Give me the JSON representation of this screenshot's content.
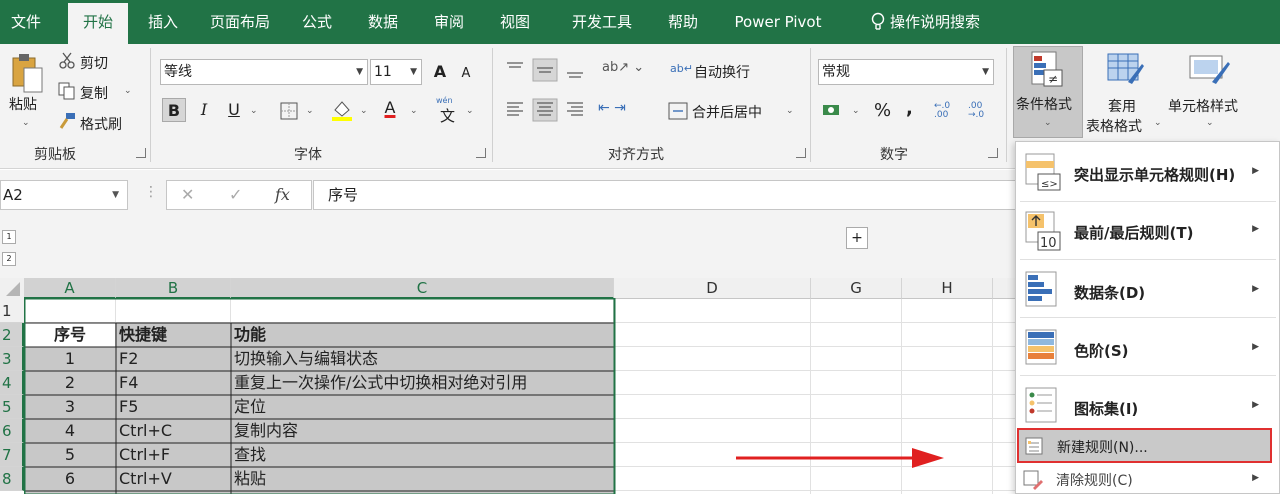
{
  "tabs": [
    "文件",
    "开始",
    "插入",
    "页面布局",
    "公式",
    "数据",
    "审阅",
    "视图",
    "开发工具",
    "帮助",
    "Power Pivot"
  ],
  "tell_me": "操作说明搜索",
  "ribbon": {
    "clipboard": {
      "paste": "粘贴",
      "cut": "剪切",
      "copy": "复制",
      "format_painter": "格式刷",
      "label": "剪贴板"
    },
    "font": {
      "name": "等线",
      "size": "11",
      "bold": "B",
      "italic": "I",
      "underline": "U",
      "phonetic": "wén",
      "phonetic_char": "文",
      "grow": "A",
      "shrink": "A",
      "font_color_letter": "A",
      "label": "字体"
    },
    "alignment": {
      "wrap": "自动换行",
      "merge": "合并后居中",
      "label": "对齐方式"
    },
    "number": {
      "format": "常规",
      "percent": "%",
      "comma": ",",
      "inc_dec": "←.0 .00",
      "dec_dec": ".00 →.0",
      "label": "数字"
    },
    "styles": {
      "conditional": "条件格式",
      "table_format_line1": "套用",
      "table_format_line2": "表格格式",
      "cell_styles": "单元格样式"
    }
  },
  "formula_bar": {
    "name_box": "A2",
    "cancel": "✕",
    "enter": "✓",
    "fx": "fx",
    "content": "序号"
  },
  "outline": {
    "level1": "1",
    "level2": "2",
    "expand": "+"
  },
  "sheet": {
    "columns": [
      "A",
      "B",
      "C",
      "D",
      "G",
      "H"
    ],
    "rows": [
      "1",
      "2",
      "3",
      "4",
      "5",
      "6",
      "7",
      "8"
    ],
    "header": [
      "序号",
      "快捷键",
      "功能"
    ],
    "data": [
      [
        "1",
        "F2",
        "切换输入与编辑状态"
      ],
      [
        "2",
        "F4",
        "重复上一次操作/公式中切换相对绝对引用"
      ],
      [
        "3",
        "F5",
        "定位"
      ],
      [
        "4",
        "Ctrl+C",
        "复制内容"
      ],
      [
        "5",
        "Ctrl+F",
        "查找"
      ],
      [
        "6",
        "Ctrl+V",
        "粘贴"
      ]
    ]
  },
  "cf_menu": {
    "highlight_rules": "突出显示单元格规则(H)",
    "top_bottom": "最前/最后规则(T)",
    "data_bars": "数据条(D)",
    "color_scales": "色阶(S)",
    "icon_sets": "图标集(I)",
    "new_rule": "新建规则(N)...",
    "clear_rules": "清除规则(C)",
    "icon_text_10": "10",
    "icon_text_le": "≤>"
  },
  "colors": {
    "excel_green": "#217346",
    "selection_fill": "#c8c8c8",
    "highlight_border": "#e03030",
    "arrow": "#e02020"
  }
}
